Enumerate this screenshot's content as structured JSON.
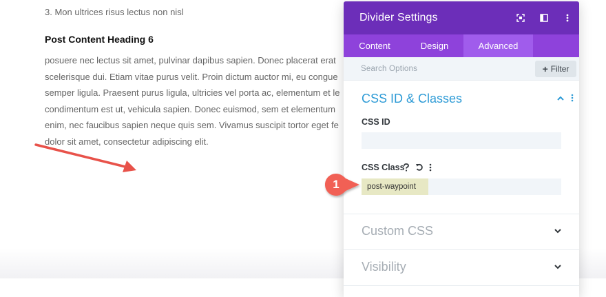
{
  "content": {
    "cut_line": "",
    "list_item_3": "3. Mon ultrices risus lectus non nisl",
    "heading": "Post Content Heading 6",
    "paragraph_lines": [
      "posuere nec lectus sit amet, pulvinar dapibus sapien. Donec placerat erat",
      "scelerisque dui. Etiam vitae purus velit. Proin dictum auctor mi, eu congue",
      "semper ligula. Praesent purus ligula, ultricies vel porta ac, elementum et le",
      "condimentum est ut, vehicula sapien. Donec euismod, sem et elementum",
      "enim, nec faucibus sapien neque quis sem. Vivamus suscipit tortor eget fe",
      "dolor sit amet, consectetur adipiscing elit."
    ]
  },
  "panel": {
    "title": "Divider Settings",
    "header_icons": [
      "focus-icon",
      "sidebar-toggle-icon",
      "more-vertical-icon"
    ],
    "tabs": [
      {
        "label": "Content"
      },
      {
        "label": "Design"
      },
      {
        "label": "Advanced"
      }
    ],
    "active_tab": "Advanced",
    "search_placeholder": "Search Options",
    "filter_label": "Filter",
    "section_css": {
      "title": "CSS ID & Classes",
      "css_id_label": "CSS ID",
      "css_id_value": "",
      "css_class_label": "CSS Class",
      "css_class_value": "post-waypoint"
    },
    "collapsed_sections": [
      {
        "title": "Custom CSS"
      },
      {
        "title": "Visibility"
      }
    ]
  },
  "annotation": {
    "badge_number": "1"
  },
  "colors": {
    "header": "#6c2eb9",
    "tabs": "#8e42db",
    "active_tab": "#a05cec",
    "section_title": "#2e9bd6",
    "badge": "#f16154",
    "arrow": "#e8524a"
  }
}
